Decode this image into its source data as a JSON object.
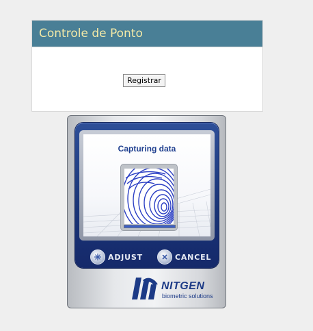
{
  "panel": {
    "title": "Controle de Ponto",
    "register_button": "Registrar"
  },
  "device": {
    "status_text": "Capturing data",
    "progress": 1.0,
    "buttons": [
      {
        "label": "ADJUST",
        "icon": "adjust-icon"
      },
      {
        "label": "CANCEL",
        "icon": "cancel-icon"
      }
    ],
    "brand": {
      "name": "NITGEN",
      "tagline": "biometric solutions"
    }
  },
  "colors": {
    "header_bg": "#497f96",
    "header_text": "#f3e9a7",
    "bezel": "#1a3477",
    "brand": "#1c3a86"
  }
}
